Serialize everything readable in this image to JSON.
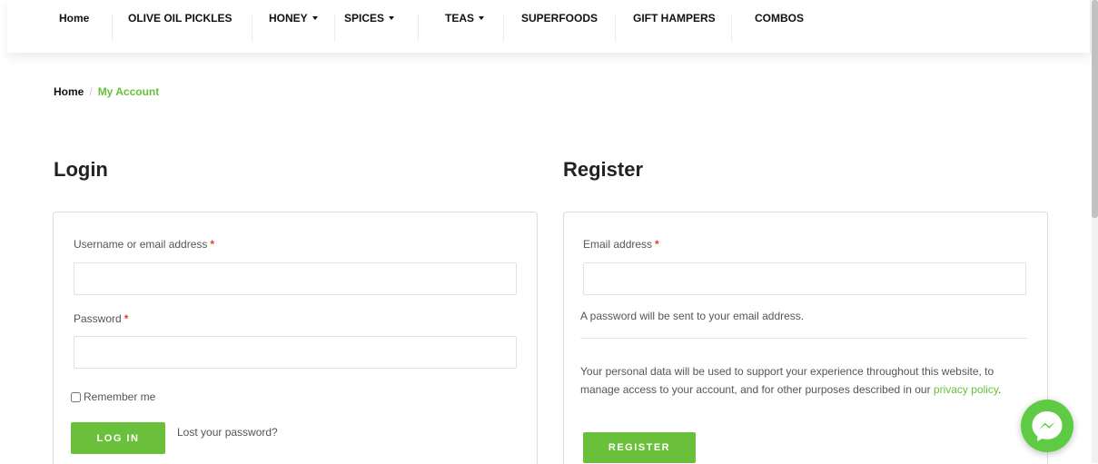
{
  "nav": {
    "items": [
      {
        "label": "Home"
      },
      {
        "label": "OLIVE OIL PICKLES"
      },
      {
        "label": "HONEY"
      },
      {
        "label": "SPICES"
      },
      {
        "label": "TEAS"
      },
      {
        "label": "SUPERFOODS"
      },
      {
        "label": "GIFT HAMPERS"
      },
      {
        "label": "COMBOS"
      }
    ]
  },
  "breadcrumb": {
    "home": "Home",
    "separator": "/",
    "current": "My Account"
  },
  "login": {
    "title": "Login",
    "username_label": "Username or email address",
    "password_label": "Password",
    "required_mark": "*",
    "remember_label": "Remember me",
    "remember_checked": false,
    "button_label": "LOG IN",
    "lost_password": "Lost your password?"
  },
  "register": {
    "title": "Register",
    "email_label": "Email address",
    "required_mark": "*",
    "password_note": "A password will be sent to your email address.",
    "privacy_text": "Your personal data will be used to support your experience throughout this website, to manage access to your account, and for other purposes described in our",
    "privacy_link": "privacy policy",
    "privacy_end": ".",
    "button_label": "REGISTER"
  },
  "widgets": {
    "messenger_icon": "messenger-chat-icon"
  },
  "colors": {
    "accent": "#6ac03a",
    "required": "#e2401c",
    "messenger": "#5fcb45"
  }
}
